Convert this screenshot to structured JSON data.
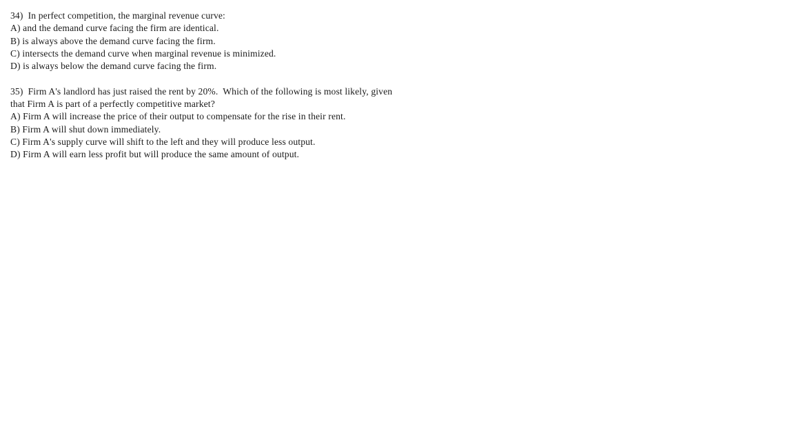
{
  "document": {
    "page_background": "#ffffff",
    "text_color": "#1a1a1a",
    "questions": [
      {
        "number": "34)",
        "stem_lines": [
          "34)  In perfect competition, the marginal revenue curve:"
        ],
        "choices": [
          "A) and the demand curve facing the firm are identical.",
          "B) is always above the demand curve facing the firm.",
          "C) intersects the demand curve when marginal revenue is minimized.",
          "D) is always below the demand curve facing the firm."
        ]
      },
      {
        "number": "35)",
        "stem_lines": [
          "35)  Firm A's landlord has just raised the rent by 20%.  Which of the following is most likely, given",
          "that Firm A is part of a perfectly competitive market?"
        ],
        "choices": [
          "A) Firm A will increase the price of their output to compensate for the rise in their rent.",
          "B) Firm A will shut down immediately.",
          "C) Firm A's supply curve will shift to the left and they will produce less output.",
          "D) Firm A will earn less profit but will produce the same amount of output."
        ]
      }
    ]
  }
}
